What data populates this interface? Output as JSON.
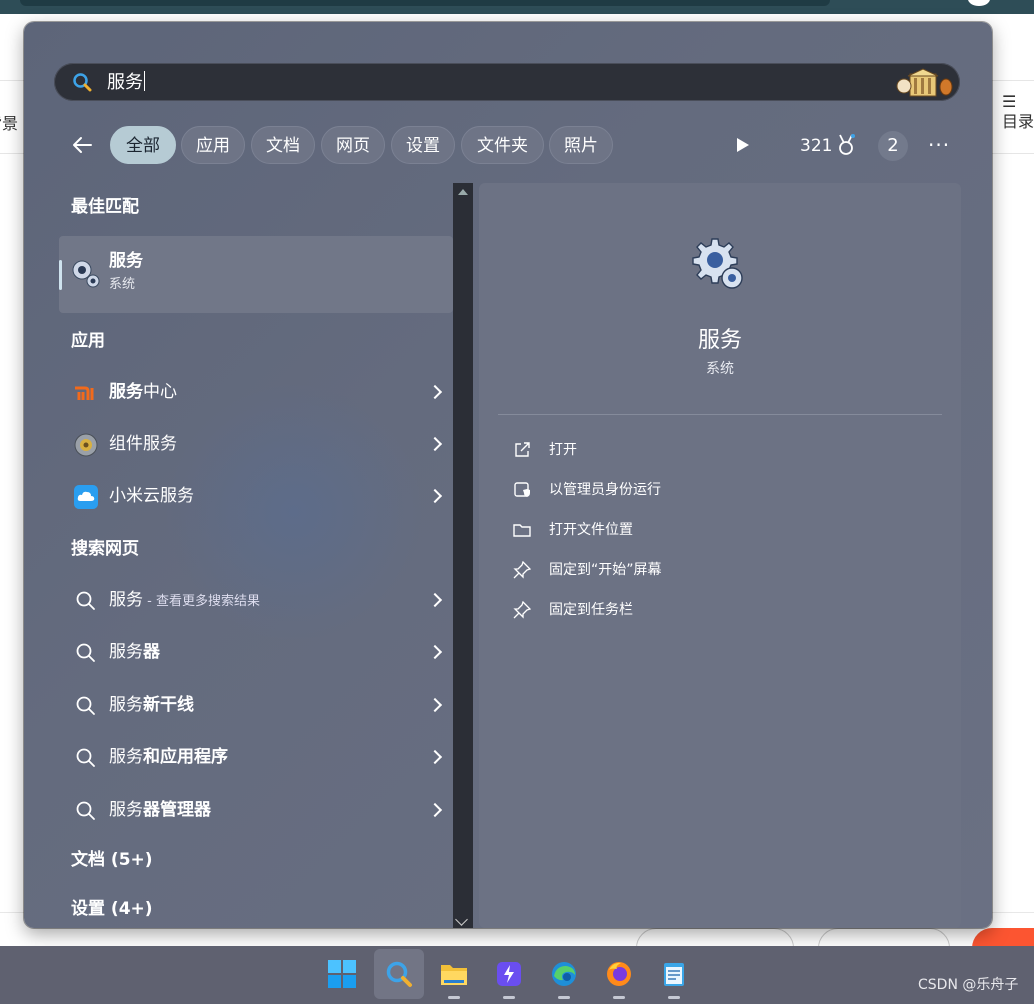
{
  "background_app": {
    "left_label": "背景",
    "right_label": "目录"
  },
  "search": {
    "query": "服务"
  },
  "filters": {
    "chips": [
      "全部",
      "应用",
      "文档",
      "网页",
      "设置",
      "文件夹",
      "照片"
    ],
    "points": "321",
    "count": "2",
    "more": "···"
  },
  "results": {
    "best_match_header": "最佳匹配",
    "best_match": {
      "title": "服务",
      "subtitle": "系统"
    },
    "apps_header": "应用",
    "apps": [
      {
        "bold": "服务",
        "rest": "中心",
        "icon": "mi-icon"
      },
      {
        "bold": "",
        "rest": "组件服务",
        "icon": "component-services-icon"
      },
      {
        "bold": "",
        "rest": "小米云服务",
        "icon": "xiaomi-cloud-icon"
      }
    ],
    "web_header": "搜索网页",
    "web": [
      {
        "bold": "",
        "rest": "服务",
        "hint": " - 查看更多搜索结果"
      },
      {
        "bold": "服务",
        "rest": "器"
      },
      {
        "bold": "服务",
        "rest": "新干线"
      },
      {
        "bold": "服务",
        "rest": "和应用程序"
      },
      {
        "bold": "服务",
        "rest": "器管理器"
      }
    ],
    "docs_header": "文档 (5+)",
    "settings_header": "设置 (4+)"
  },
  "preview": {
    "name": "服务",
    "category": "系统",
    "actions": [
      "打开",
      "以管理员身份运行",
      "打开文件位置",
      "固定到“开始”屏幕",
      "固定到任务栏"
    ]
  },
  "watermark": "CSDN @乐舟子",
  "colors": {
    "accent_chip": "#b6cbd4",
    "panel": "#646b7e",
    "taskbar": "#5f6170"
  }
}
